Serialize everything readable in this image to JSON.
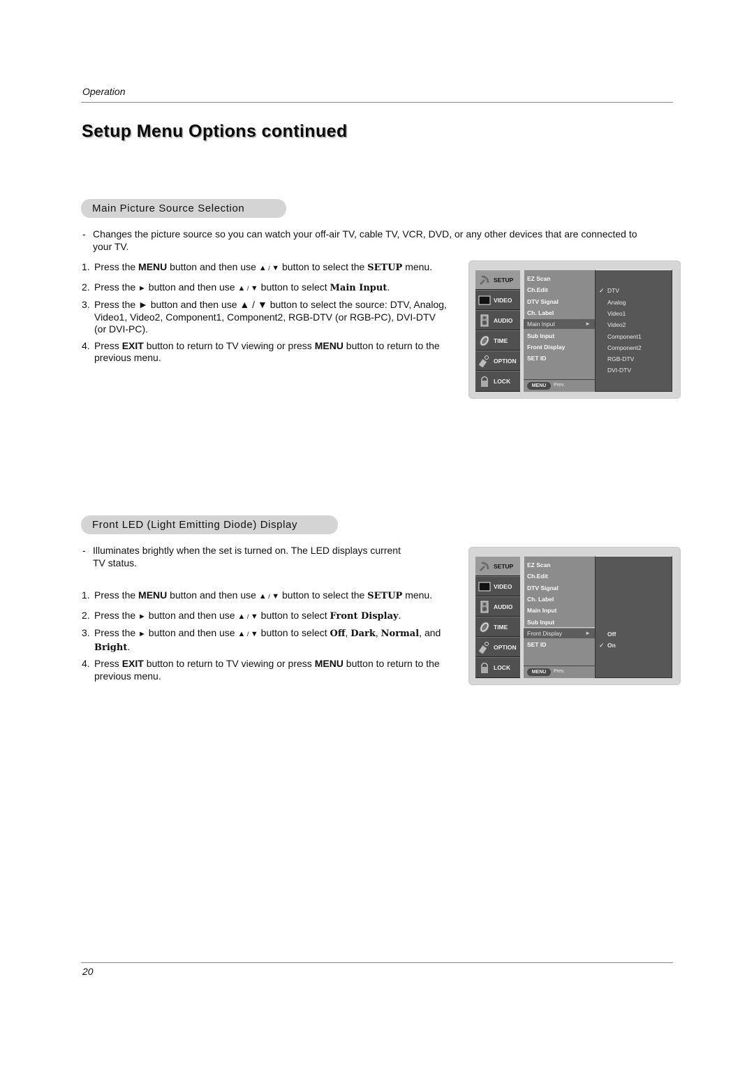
{
  "header": {
    "running_head": "Operation",
    "page_title": "Setup Menu Options continued"
  },
  "footer": {
    "page_number": "20"
  },
  "sections": [
    {
      "heading": "Main Picture Source Selection",
      "description_lines": [
        "Changes the picture source so you can watch your off-air TV, cable TV, VCR, DVD, or any other devices that are connected to",
        "your TV."
      ],
      "steps": [
        {
          "num": "1.",
          "parts": [
            "Press the ",
            "MENU",
            " button and then use ",
            "▲",
            " / ",
            "▼",
            "  button to select the ",
            "SETUP",
            " menu."
          ]
        },
        {
          "num": "2.",
          "parts": [
            "Press the ",
            "►",
            "  button and then use ",
            "▲",
            " / ",
            "▼",
            " button to select ",
            "Main Input",
            "."
          ]
        },
        {
          "num": "3.",
          "lines": [
            "Press the ► button and then use ▲ / ▼ button to select the source: DTV, Analog,",
            "Video1, Video2, Component1, Component2, RGB-DTV (or RGB-PC), DVI-DTV",
            "(or DVI-PC)."
          ]
        },
        {
          "num": "4.",
          "parts": [
            "Press ",
            "EXIT",
            " button to return to TV viewing or press ",
            "MENU",
            " button to return to the"
          ],
          "line2": "previous menu."
        }
      ],
      "tv_menu": {
        "tabs": [
          {
            "label": "SETUP",
            "icon": "satellite-dish-icon",
            "active": true
          },
          {
            "label": "VIDEO",
            "icon": "monitor-icon"
          },
          {
            "label": "AUDIO",
            "icon": "speaker-icon"
          },
          {
            "label": "TIME",
            "icon": "clock-icon"
          },
          {
            "label": "OPTION",
            "icon": "tag-icon"
          },
          {
            "label": "LOCK",
            "icon": "padlock-icon"
          }
        ],
        "items": [
          "EZ Scan",
          "Ch.Edit",
          "DTV Signal",
          "Ch. Label",
          "Main Input",
          "Sub Input",
          "Front Display",
          "SET ID"
        ],
        "selected_item": "Main Input",
        "menu_button": "MENU",
        "prev_label": "Prev.",
        "options": [
          "DTV",
          "Analog",
          "Video1",
          "Video2",
          "Component1",
          "Component2",
          "RGB-DTV",
          "DVI-DTV"
        ],
        "checked_option": "DTV"
      }
    },
    {
      "heading": "Front LED (Light Emitting Diode) Display",
      "description_lines": [
        "Illuminates brightly when the set is turned on. The LED displays current",
        "TV status."
      ],
      "steps": [
        {
          "num": "1.",
          "parts": [
            "Press the ",
            "MENU",
            " button and then use ",
            "▲",
            " / ",
            "▼",
            "  button to select the ",
            "SETUP",
            " menu."
          ]
        },
        {
          "num": "2.",
          "parts": [
            "Press the ",
            "►",
            "  button and then use ",
            "▲",
            " / ",
            "▼",
            " button to select ",
            "Front Display",
            "."
          ]
        },
        {
          "num": "3.",
          "parts": [
            "Press the ",
            "►",
            " button and then use ",
            "▲",
            " / ",
            "▼",
            " button to select ",
            "Off",
            ", ",
            "Dark",
            ", ",
            "Normal",
            ", and"
          ],
          "line2_bold": "Bright",
          "line2_tail": "."
        },
        {
          "num": "4.",
          "parts": [
            "Press ",
            "EXIT",
            " button to return to TV viewing or press ",
            "MENU",
            " button to return to the"
          ],
          "line2": "previous menu."
        }
      ],
      "tv_menu": {
        "tabs": [
          {
            "label": "SETUP",
            "icon": "satellite-dish-icon",
            "active": true
          },
          {
            "label": "VIDEO",
            "icon": "monitor-icon"
          },
          {
            "label": "AUDIO",
            "icon": "speaker-icon"
          },
          {
            "label": "TIME",
            "icon": "clock-icon"
          },
          {
            "label": "OPTION",
            "icon": "tag-icon"
          },
          {
            "label": "LOCK",
            "icon": "padlock-icon"
          }
        ],
        "items": [
          "EZ Scan",
          "Ch.Edit",
          "DTV Signal",
          "Ch. Label",
          "Main Input",
          "Sub Input",
          "Front Display",
          "SET ID"
        ],
        "selected_item": "Front Display",
        "menu_button": "MENU",
        "prev_label": "Prev.",
        "options": [
          "Off",
          "On"
        ],
        "checked_option": "On"
      }
    }
  ]
}
